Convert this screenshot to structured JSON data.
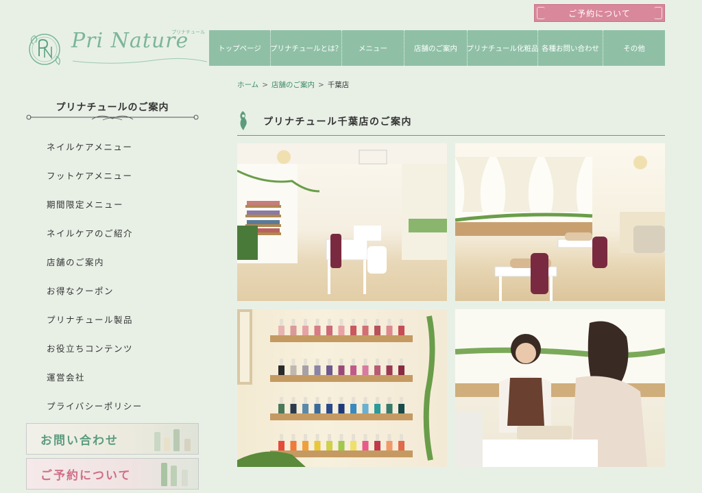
{
  "header": {
    "reserve_button": "ご予約について",
    "logo_text": "Pri Nature",
    "logo_small": "プリナチュール"
  },
  "nav": [
    "トップページ",
    "プリナチュールとは？",
    "メニュー",
    "店舗のご案内",
    "プリナチュール化粧品",
    "各種お問い合わせ",
    "その他"
  ],
  "sidebar": {
    "title": "プリナチュールのご案内",
    "items": [
      "ネイルケアメニュー",
      "フットケアメニュー",
      "期間限定メニュー",
      "ネイルケアのご紹介",
      "店舗のご案内",
      "お得なクーポン",
      "プリナチュール製品",
      "お役立ちコンテンツ",
      "運営会社",
      "プライバシーポリシー"
    ],
    "banner_contact": "お問い合わせ",
    "banner_reserve": "ご予約について"
  },
  "breadcrumb": {
    "home": "ホーム",
    "stores": "店舗のご案内",
    "current": "千葉店",
    "separator": ">"
  },
  "main": {
    "heading": "プリナチュール千葉店のご案内"
  },
  "colors": {
    "background": "#e8f0e6",
    "nav": "#8fc0a6",
    "accent_green": "#3d8a66",
    "reserve_pink": "#d9889b"
  }
}
